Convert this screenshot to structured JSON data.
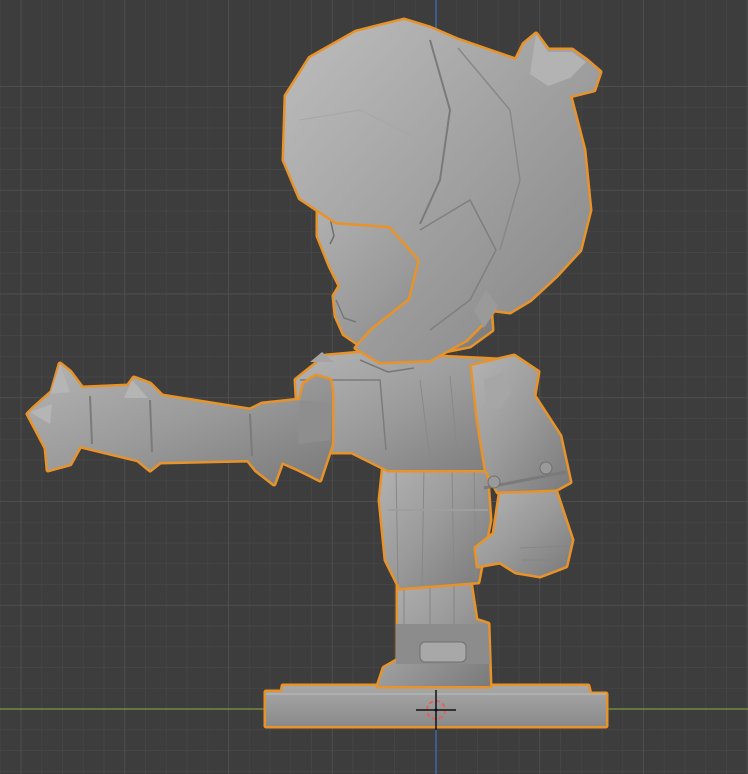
{
  "viewport": {
    "background": "#3d3d3d",
    "grid_minor": "#454545",
    "grid_major": "#4e4e4e",
    "axis_x_color": "#7a9a3c",
    "axis_z_color": "#3d74c2"
  },
  "object": {
    "name": "character-figurine",
    "selected": true,
    "outline_color": "#e8932a",
    "mesh_color": "#8d8d8d",
    "mesh_light": "#b0b0b0",
    "mesh_dark": "#6a6a6a"
  },
  "cursor": {
    "icon": "3d-cursor-icon",
    "ring_color": "#e06060",
    "ring_alt": "#ffffff"
  }
}
